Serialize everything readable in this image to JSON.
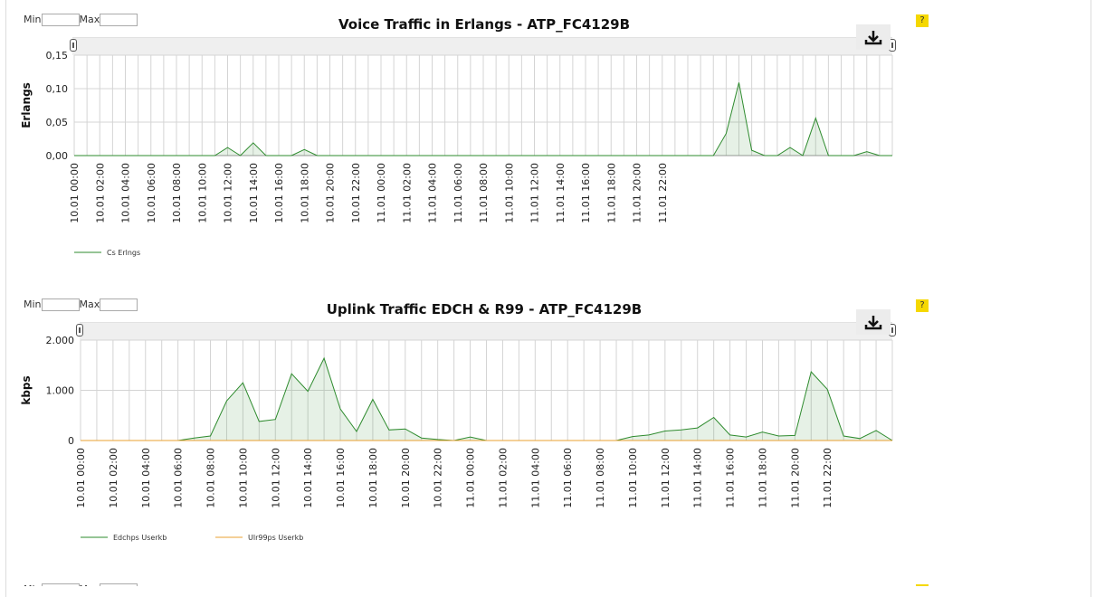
{
  "controls": {
    "min_label": "Min",
    "max_label": "Max",
    "help_label": "?"
  },
  "chart_data": [
    {
      "type": "area",
      "title": "Voice Traffic in Erlangs - ATP_FC4129B",
      "xlabel": "",
      "ylabel": "Erlangs",
      "ylim": [
        0,
        0.15
      ],
      "yticks": [
        0,
        0.05,
        0.1,
        0.15
      ],
      "ytick_labels": [
        "0,00",
        "0,05",
        "0,10",
        "0,15"
      ],
      "xtick_labels": [
        "10.01 00:00",
        "10.01 02:00",
        "10.01 04:00",
        "10.01 06:00",
        "10.01 08:00",
        "10.01 10:00",
        "10.01 12:00",
        "10.01 14:00",
        "10.01 16:00",
        "10.01 18:00",
        "10.01 20:00",
        "10.01 22:00",
        "11.01 00:00",
        "11.01 02:00",
        "11.01 04:00",
        "11.01 06:00",
        "11.01 08:00",
        "11.01 10:00",
        "11.01 12:00",
        "11.01 14:00",
        "11.01 16:00",
        "11.01 18:00",
        "11.01 20:00",
        "11.01 22:00"
      ],
      "grid": true,
      "legend_position": "bottom-left",
      "series": [
        {
          "name": "Cs Erlngs",
          "color": "#2e8b2e",
          "values": [
            0,
            0,
            0,
            0,
            0,
            0,
            0,
            0,
            0,
            0,
            0,
            0,
            0.012,
            0,
            0.019,
            0,
            0,
            0,
            0.009,
            0,
            0,
            0,
            0,
            0,
            0,
            0,
            0,
            0,
            0,
            0,
            0,
            0,
            0,
            0,
            0,
            0,
            0,
            0,
            0,
            0,
            0,
            0,
            0,
            0,
            0,
            0,
            0,
            0,
            0,
            0,
            0,
            0.033,
            0.109,
            0.008,
            0,
            0,
            0.012,
            0,
            0.056,
            0,
            0,
            0,
            0.006,
            0,
            0
          ]
        }
      ]
    },
    {
      "type": "area",
      "title": "Uplink Traffic EDCH & R99 - ATP_FC4129B",
      "xlabel": "",
      "ylabel": "kbps",
      "ylim": [
        0,
        2000
      ],
      "yticks": [
        0,
        1000,
        2000
      ],
      "ytick_labels": [
        "0",
        "1.000",
        "2.000"
      ],
      "xtick_labels": [
        "10.01 00:00",
        "10.01 02:00",
        "10.01 04:00",
        "10.01 06:00",
        "10.01 08:00",
        "10.01 10:00",
        "10.01 12:00",
        "10.01 14:00",
        "10.01 16:00",
        "10.01 18:00",
        "10.01 20:00",
        "10.01 22:00",
        "11.01 00:00",
        "11.01 02:00",
        "11.01 04:00",
        "11.01 06:00",
        "11.01 08:00",
        "11.01 10:00",
        "11.01 12:00",
        "11.01 14:00",
        "11.01 16:00",
        "11.01 18:00",
        "11.01 20:00",
        "11.01 22:00"
      ],
      "grid": true,
      "legend_position": "bottom-left",
      "series": [
        {
          "name": "Edchps Userkb",
          "color": "#2e8b2e",
          "values": [
            0,
            0,
            0,
            0,
            0,
            0,
            0,
            50,
            90,
            790,
            1150,
            380,
            420,
            1330,
            980,
            1640,
            630,
            180,
            820,
            210,
            230,
            50,
            20,
            0,
            70,
            0,
            0,
            0,
            0,
            0,
            0,
            0,
            0,
            0,
            80,
            110,
            190,
            210,
            250,
            460,
            110,
            70,
            170,
            90,
            100,
            1370,
            1020,
            90,
            40,
            200,
            0
          ]
        },
        {
          "name": "Ulr99ps Userkb",
          "color": "#e8a030",
          "values": [
            0,
            0,
            0,
            0,
            0,
            0,
            0,
            0,
            0,
            0,
            0,
            0,
            0,
            0,
            0,
            0,
            0,
            0,
            0,
            0,
            0,
            0,
            0,
            0,
            0,
            0,
            0,
            0,
            0,
            0,
            0,
            0,
            0,
            0,
            0,
            0,
            0,
            0,
            0,
            0,
            0,
            0,
            0,
            0,
            0,
            0,
            0,
            0,
            0,
            0,
            0
          ]
        }
      ]
    }
  ]
}
